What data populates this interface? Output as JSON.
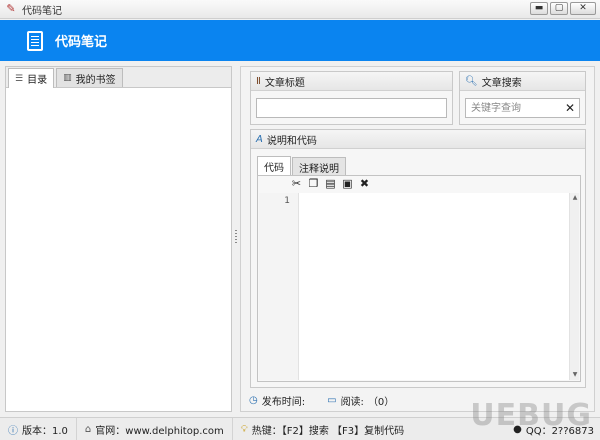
{
  "window": {
    "title": "代码笔记",
    "buttons": {
      "minimize": "▬",
      "maximize": "▢",
      "close": "✕"
    }
  },
  "header": {
    "app_name": "代码笔记",
    "logo_icon": "notebook-icon"
  },
  "left_panel": {
    "tabs": [
      {
        "label": "目录",
        "icon": "list-icon",
        "active": true
      },
      {
        "label": "我的书签",
        "icon": "bookmark-icon",
        "active": false
      }
    ]
  },
  "article_title": {
    "label": "文章标题",
    "icon": "title-icon",
    "value": ""
  },
  "article_search": {
    "label": "文章搜索",
    "icon": "search-icon",
    "placeholder": "关键字查询",
    "clear": "✕"
  },
  "desc_code": {
    "label": "说明和代码",
    "icon": "text-icon",
    "tabs": [
      {
        "label": "代码",
        "active": true
      },
      {
        "label": "注释说明",
        "active": false
      }
    ],
    "toolbar": [
      "cut-icon",
      "copy-icon",
      "paste-icon",
      "save-icon",
      "close-icon"
    ],
    "line_number": "1"
  },
  "info": {
    "publish_label": "发布时间:",
    "read_label": "阅读:",
    "read_count": "（0）"
  },
  "statusbar": {
    "version": "版本：1.0",
    "website": "官网：www.delphitop.com",
    "hotkeys": "热键：【F2】搜索 【F3】复制代码",
    "qq": "QQ：2??6873"
  },
  "watermark": "UEBUG"
}
